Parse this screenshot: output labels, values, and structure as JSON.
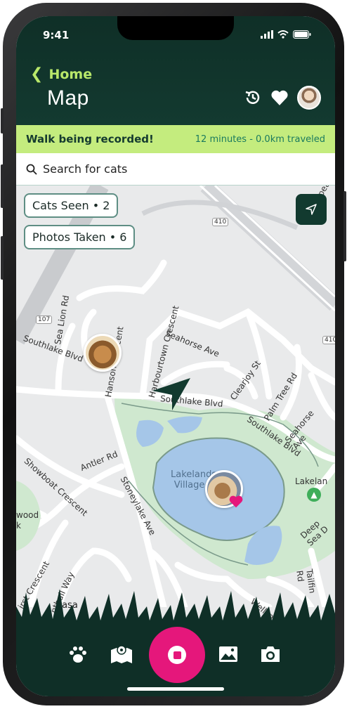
{
  "status": {
    "time": "9:41"
  },
  "header": {
    "back_label": "Home",
    "title": "Map"
  },
  "banner": {
    "message": "Walk being recorded!",
    "stats": "12 minutes - 0.0km traveled"
  },
  "search": {
    "placeholder": "Search for cats"
  },
  "chips": {
    "cats_seen": "Cats Seen • 2",
    "photos_taken": "Photos Taken • 6"
  },
  "map_labels": {
    "southlake_blvd": "Southlake Blvd",
    "southlake_blvd_2": "Southlake Blvd",
    "southlake_blvd_3": "Southlake Blvd",
    "sea_lion_rd": "Sea Lion Rd",
    "hanson_crescent": "Hanson Crescent",
    "harbourtown_crescent": "Harbourtown Crescent",
    "seahorse_ave": "Seahorse Ave",
    "seahorse_ave_2": "Seahorse Ave",
    "clearjoy_st": "Clearjoy St",
    "palm_tree_rd": "Palm Tree Rd",
    "nepean": "Nepean",
    "antler_rd": "Antler Rd",
    "showboat_crescent": "Showboat Crescent",
    "stoneylake_ave": "Stoneylake Ave",
    "lakelands_village": "Lakelands Village P",
    "lakelands_village_line1": "Lakelands",
    "lakelands_village_line2": "Village P",
    "lakelan": "Lakelan",
    "deep_sea_d": "Deep Sea D",
    "wood": "wood",
    "k": "k",
    "first_crescent": "irst Crescent",
    "nthall_way": "nthall Way",
    "casa": "Casa",
    "wellsp": "Wellsp",
    "tailfin_rd": "Tailfin Rd",
    "hwy_410": "410",
    "hwy_410b": "410",
    "hwy_107": "107"
  },
  "colors": {
    "header_bg": "#133a30",
    "accent_green": "#b9e86a",
    "banner_bg": "#c4ec7e",
    "record_pink": "#e5177b",
    "water": "#a5c6e8",
    "park": "#cfe8cf"
  },
  "icons": {
    "history": "history-icon",
    "favorites": "heart-icon",
    "paw": "paw-icon",
    "map": "map-icon",
    "record": "record-stop-icon",
    "gallery": "image-icon",
    "camera": "camera-icon"
  }
}
